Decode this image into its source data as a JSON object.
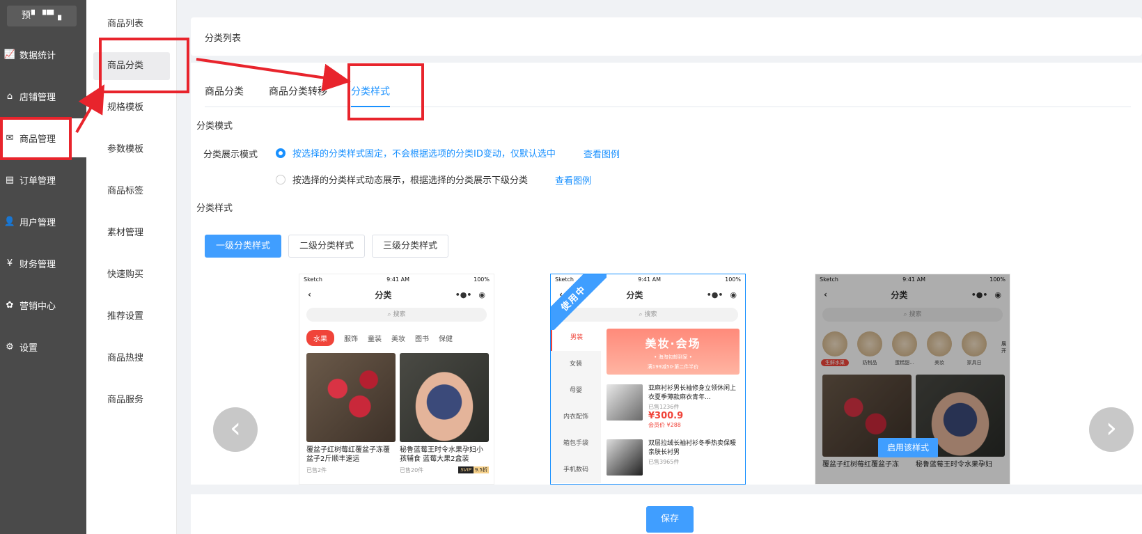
{
  "brand": "预▘▝▀▗",
  "sidebar": [
    {
      "label": "数据统计",
      "icon": "chart-icon"
    },
    {
      "label": "店铺管理",
      "icon": "shop-icon"
    },
    {
      "label": "商品管理",
      "icon": "goods-icon",
      "active": true
    },
    {
      "label": "订单管理",
      "icon": "order-icon"
    },
    {
      "label": "用户管理",
      "icon": "user-icon"
    },
    {
      "label": "财务管理",
      "icon": "finance-icon"
    },
    {
      "label": "营销中心",
      "icon": "marketing-icon"
    },
    {
      "label": "设置",
      "icon": "gear-icon"
    }
  ],
  "submenu": [
    "商品列表",
    "商品分类",
    "规格模板",
    "参数模板",
    "商品标签",
    "素材管理",
    "快速购买",
    "推荐设置",
    "商品热搜",
    "商品服务"
  ],
  "breadcrumb": "分类列表",
  "tabs": [
    "商品分类",
    "商品分类转移",
    "分类样式"
  ],
  "mode": {
    "section_title": "分类模式",
    "label": "分类展示模式",
    "option1": "按选择的分类样式固定，不会根据选项的分类ID变动，仅默认选中",
    "option2": "按选择的分类样式动态展示，根据选择的分类展示下级分类",
    "example_link": "查看图例"
  },
  "style": {
    "section_title": "分类样式",
    "buttons": [
      "一级分类样式",
      "二级分类样式",
      "三级分类样式"
    ]
  },
  "phone": {
    "carrier": "Sketch",
    "time": "9:41 AM",
    "battery": "100%",
    "title": "分类",
    "search": "搜索",
    "dots": "•●•"
  },
  "preview1": {
    "cats": [
      "水果",
      "服饰",
      "童装",
      "美妆",
      "图书",
      "保健"
    ],
    "cards": [
      {
        "title": "覆盆子红树莓红覆盆子冻覆盆子2斤顺丰速运",
        "sold": "已售2件"
      },
      {
        "title": "秘鲁蓝莓王时令水果孕妇小孩辅食 蓝莓大果2盒装",
        "sold": "已售20件"
      }
    ],
    "svip": "SVIP",
    "discount": "9.5折"
  },
  "preview2": {
    "badge": "使用中",
    "cats": [
      "男装",
      "女装",
      "母婴",
      "内衣配饰",
      "箱包手袋",
      "手机数码"
    ],
    "banner_title": "美妆·会场",
    "banner_sub1": "• 海淘包邮到家 •",
    "banner_sub2": "满199减50·第二件半价",
    "items": [
      {
        "title": "亚麻衬衫男长袖修身立领休闲上衣夏季薄款麻衣青年...",
        "sold": "已售1236件",
        "price": "¥300.9",
        "member": "会员价 ¥288"
      },
      {
        "title": "双层拉绒长袖衬衫冬季热卖保暖亲肤长衬男",
        "sold": "已售3965件"
      }
    ]
  },
  "preview3": {
    "cats": [
      "生鲜水果",
      "奶制品",
      "蛋糕甜...",
      "美妆",
      "家具日"
    ],
    "side_label": "展开",
    "cards": [
      {
        "title": "覆盆子红树莓红覆盆子冻"
      },
      {
        "title": "秘鲁蓝莓王时令水果孕妇"
      }
    ],
    "use_button": "启用该样式"
  },
  "save": "保存"
}
